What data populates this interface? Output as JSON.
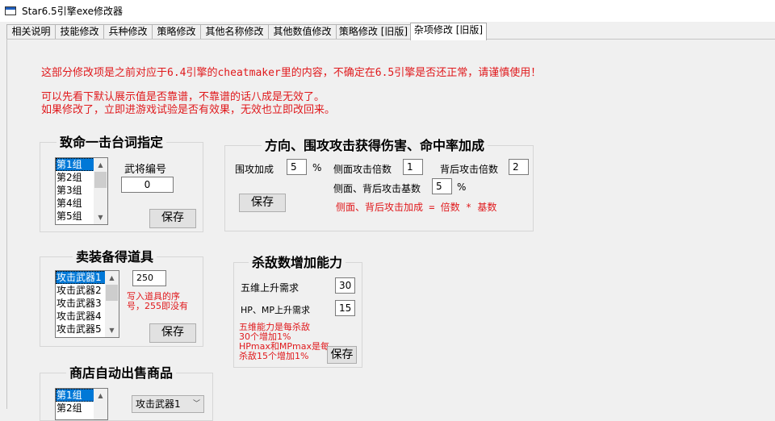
{
  "window": {
    "title": "Star6.5引擎exe修改器"
  },
  "tabs": [
    "相关说明",
    "技能修改",
    "兵种修改",
    "策略修改",
    "其他名称修改",
    "其他数值修改",
    "策略修改 [旧版]",
    "杂项修改 [旧版]"
  ],
  "notice": {
    "line1": "这部分修改项是之前对应于6.4引擎的cheatmaker里的内容，不确定在6.5引擎是否还正常，请谨慎使用！",
    "line2": "可以先看下默认展示值是否靠谱，不靠谱的话八成是无效了。",
    "line3": "如果修改了，立即进游戏试验是否有效果，无效也立即改回来。"
  },
  "critical": {
    "title": "致命一击台词指定",
    "items": [
      "第1组",
      "第2组",
      "第3组",
      "第4组",
      "第5组"
    ],
    "general_label": "武将编号",
    "general_value": "0",
    "save": "保存"
  },
  "shop_sell": {
    "title": "卖装备得道具",
    "items": [
      "攻击武器1",
      "攻击武器2",
      "攻击武器3",
      "攻击武器4",
      "攻击武器5"
    ],
    "value": "250",
    "hint_line1": "写入道具的序",
    "hint_line2": "号，255即没有",
    "save": "保存"
  },
  "auto_sell": {
    "title": "商店自动出售商品",
    "items": [
      "第1组",
      "第2组"
    ],
    "select_value": "攻击武器1"
  },
  "direction": {
    "title": "方向、围攻攻击获得伤害、命中率加成",
    "siege_label": "围攻加成",
    "siege_value": "5",
    "siege_unit": "%",
    "side_mult_label": "侧面攻击倍数",
    "side_mult_value": "1",
    "back_mult_label": "背后攻击倍数",
    "back_mult_value": "2",
    "base_label": "侧面、背后攻击基数",
    "base_value": "5",
    "base_unit": "%",
    "formula": "侧面、背后攻击加成 = 倍数 * 基数",
    "save": "保存"
  },
  "kills": {
    "title": "杀敌数增加能力",
    "stats_label": "五维上升需求",
    "stats_value": "30",
    "hpmp_label": "HP、MP上升需求",
    "hpmp_value": "15",
    "hint_lines": [
      "五维能力是每杀敌",
      "30个增加1%",
      "HPmax和MPmax是每",
      "杀敌15个增加1%"
    ],
    "save": "保存"
  },
  "colors": {
    "warning": "#e0191c",
    "selection": "#0078d7"
  }
}
